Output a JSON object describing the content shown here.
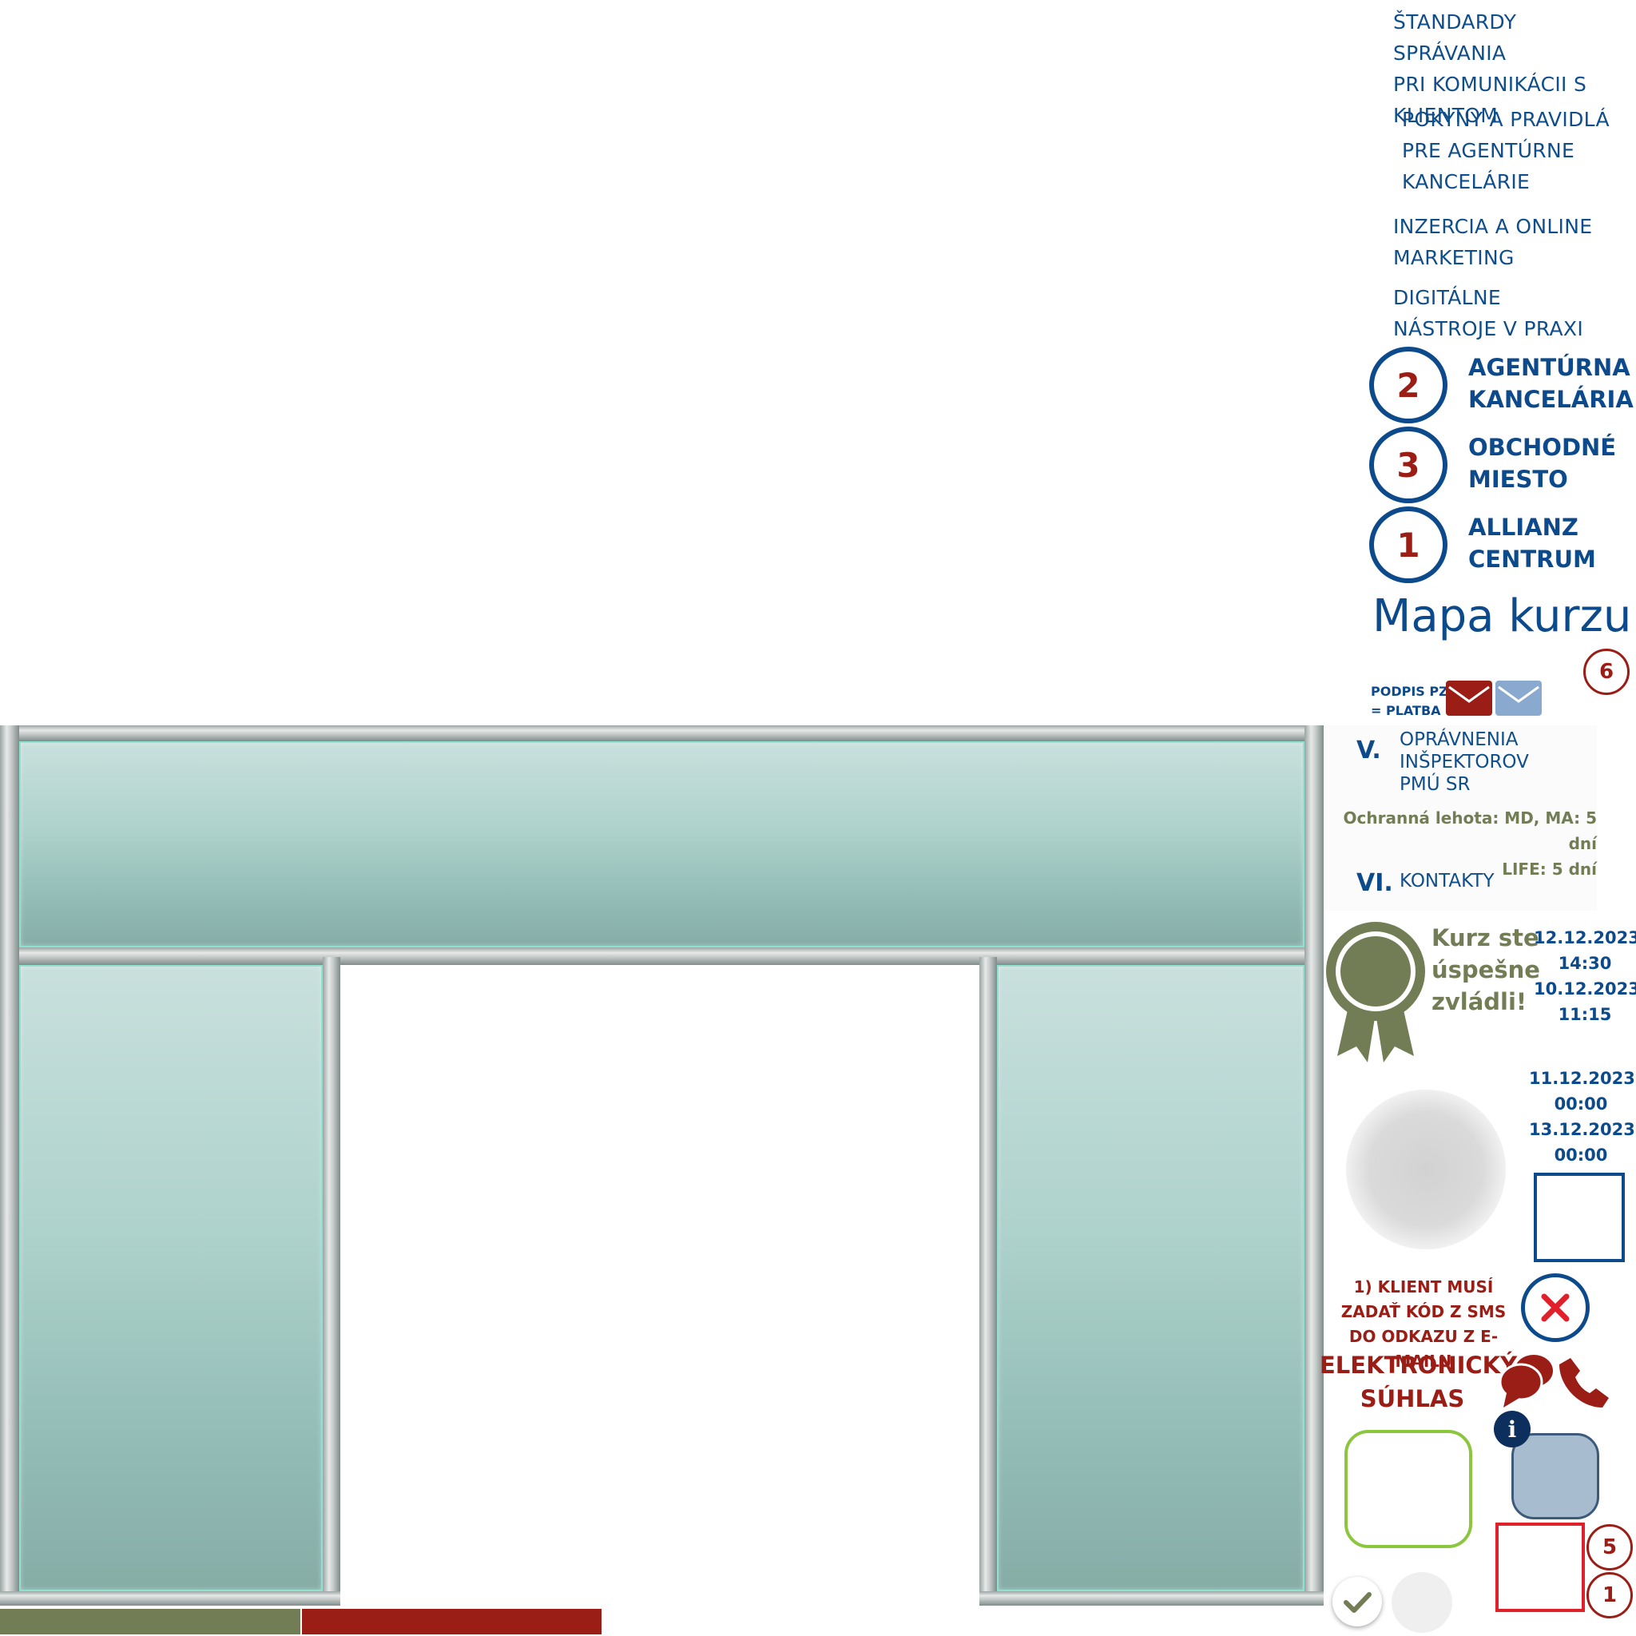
{
  "menu": {
    "item1": [
      "ŠTANDARDY SPRÁVANIA",
      "PRI KOMUNIKÁCII S",
      "KLIENTOM"
    ],
    "item2": [
      "POKYNY A PRAVIDLÁ",
      "PRE AGENTÚRNE",
      "KANCELÁRIE"
    ],
    "item3": [
      "INZERCIA A ONLINE",
      "MARKETING"
    ],
    "item4": [
      "DIGITÁLNE",
      "NÁSTROJE V PRAXI"
    ]
  },
  "course_options": [
    {
      "number": "2",
      "line1": "AGENTÚRNA",
      "line2": "KANCELÁRIA"
    },
    {
      "number": "3",
      "line1": "OBCHODNÉ",
      "line2": "MIESTO"
    },
    {
      "number": "1",
      "line1": "ALLIANZ",
      "line2": "CENTRUM"
    }
  ],
  "map_title": "Mapa kurzu",
  "badge_top": "6",
  "podpis": {
    "line1": "PODPIS PZ",
    "line2": "= PLATBA"
  },
  "sections": {
    "v_numeral": "V.",
    "v_lines": [
      "OPRÁVNENIA",
      "INŠPEKTOROV",
      "PMÚ SR"
    ],
    "protection_line1": "Ochranná lehota: MD, MA: 5 dní",
    "protection_line2": "LIFE: 5 dní",
    "vi_numeral": "VI.",
    "vi_label": "KONTAKTY"
  },
  "success": {
    "line1": "Kurz ste",
    "line2": "úspešne",
    "line3": "zvládli!"
  },
  "dates": {
    "d1": "12.12.2023",
    "t1": "14:30",
    "d2": "10.12.2023",
    "t2": "11:15",
    "d3": "11.12.2023",
    "t3": "00:00",
    "d4": "13.12.2023",
    "t4": "00:00"
  },
  "consent": {
    "line1": "1) KLIENT MUSÍ",
    "line2": "ZADAŤ KÓD Z SMS",
    "line3": "DO ODKAZU Z E-MAILU",
    "title1": "ELEKTRONICKÝ",
    "title2": "SÚHLAS"
  },
  "badges": {
    "five": "5",
    "one": "1"
  },
  "colors": {
    "blue": "#0c4a8c",
    "dark_red": "#9a1d16",
    "olive": "#727c55",
    "light_blue": "#8aa9cf",
    "green_outline": "#8cc63f"
  },
  "icons": {
    "close": "close-icon",
    "chat": "chat-bubbles-icon",
    "phone": "phone-icon",
    "info": "info-icon",
    "check": "check-icon",
    "mail": "envelope-icon",
    "award": "award-ribbon-icon"
  }
}
